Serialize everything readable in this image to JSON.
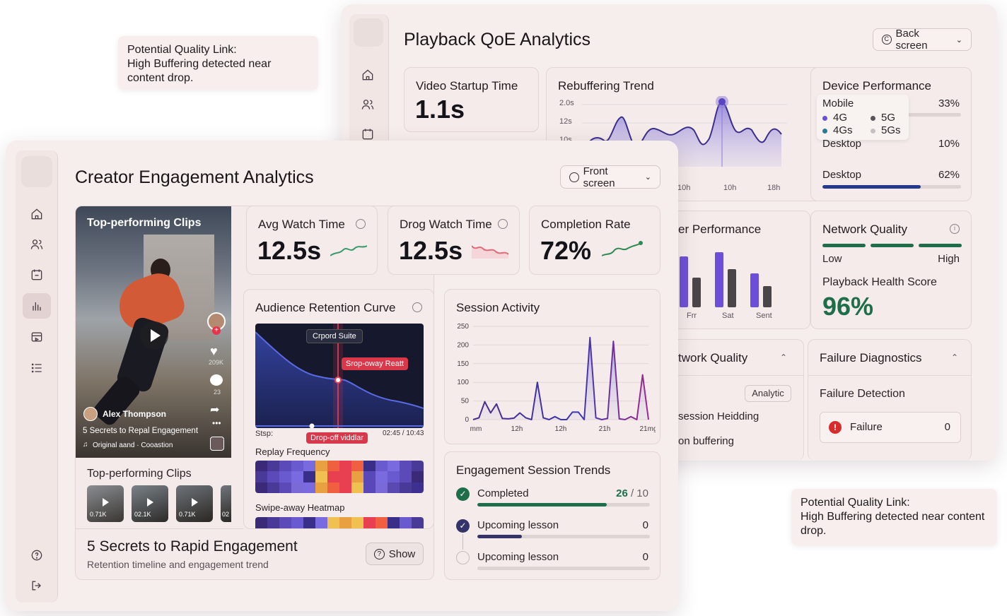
{
  "callouts": [
    {
      "title": "Potential Quality Link:",
      "body": "High Buffering detected near content drop."
    },
    {
      "title": "Potential Quality Link:",
      "body": "High Buffering detected near content drop."
    }
  ],
  "back": {
    "title": "Playback QoE Analytics",
    "screen_button": "Back screen",
    "startup": {
      "label": "Video Startup Time",
      "value": "1.1s"
    },
    "rebuffering": {
      "label": "Rebuffering Trend",
      "y_ticks": [
        "2.0s",
        "12s",
        "10s"
      ],
      "x_ticks": [
        "10h",
        "10h",
        "18h"
      ]
    },
    "device": {
      "label": "Device Performance",
      "rows": [
        {
          "name": "Mobile",
          "pct": "33%",
          "fill": 0.33,
          "color": "#6b4fd8"
        },
        {
          "name": "Desktop",
          "pct": "10%",
          "fill": 0.1,
          "color": "#2c3f8c"
        },
        {
          "name": "Desktop",
          "pct": "62%",
          "fill": 0.62,
          "color": "#243a8c"
        }
      ],
      "legend": [
        {
          "name": "4G",
          "color": "#6b4fd8"
        },
        {
          "name": "5G",
          "color": "#5a5358"
        },
        {
          "name": "4Gs",
          "color": "#2b7a9a"
        },
        {
          "name": "5Gs",
          "color": "#c9c0c4"
        }
      ]
    },
    "server": {
      "label": "er Performance",
      "x_ticks": [
        "Frr",
        "Sat",
        "Sent"
      ]
    },
    "network": {
      "label": "Network Quality",
      "low": "Low",
      "high": "High",
      "health_label": "Playback Health Score",
      "health_value": "96%"
    },
    "network2": {
      "label": "twork Quality",
      "tag": "Analytic",
      "line1": "session Heidding",
      "line2": "on buffering"
    },
    "failure": {
      "label": "Failure Diagnostics",
      "detection": "Failure Detection",
      "item": "Failure",
      "count": "0"
    }
  },
  "front": {
    "title": "Creator Engagement Analytics",
    "screen_button": "Front screen",
    "clip": {
      "header": "Top-performing Clips",
      "author": "Alex Thompson",
      "caption": "5 Secrets to Repal Engagement",
      "sound": "Original aand · Cooastion",
      "likes": "209K",
      "comments": "23"
    },
    "clips_list": {
      "label": "Top-performing Clips",
      "items": [
        "0.71K",
        "02.1K",
        "0.71K",
        "02"
      ]
    },
    "stat_cards": [
      {
        "label": "Avg Watch Time",
        "value": "12.5s",
        "trend_color": "#3a9a6a"
      },
      {
        "label": "Drog Watch Time",
        "value": "12.5s",
        "trend_color": "#e06a7a"
      },
      {
        "label": "Completion Rate",
        "value": "72%",
        "trend_color": "#2f8a52"
      }
    ],
    "retention": {
      "label": "Audience Retention Curve",
      "tip1": "Crpord Suite",
      "tip2": "Srop-oway Reatt",
      "drop_label": "Drop-off viddlar",
      "stsp": "Stsp:",
      "time": "02:45 / 10:43",
      "replay_label": "Replay Frequency",
      "swipe_label": "Swipe-away Heatmap"
    },
    "session": {
      "label": "Session Activity"
    },
    "engagement": {
      "label": "Engagement Session Trends",
      "rows": [
        {
          "name": "Completed",
          "value": "26",
          "total": "/ 10",
          "fill": 0.75
        },
        {
          "name": "Upcoming lesson",
          "value": "0",
          "fill": 0.26
        },
        {
          "name": "Upcoming lesson",
          "value": "0",
          "fill": 0
        }
      ]
    },
    "footer": {
      "title": "5 Secrets to Rapid Engagement",
      "subtitle": "Retention timeline and engagement trend",
      "button": "Show"
    }
  },
  "chart_data": [
    {
      "type": "line",
      "title": "Session Activity",
      "x_ticks": [
        "mm",
        "12h",
        "12h",
        "21h",
        "21mg"
      ],
      "y_ticks": [
        0,
        50,
        100,
        150,
        200,
        250
      ],
      "ylim": [
        0,
        250
      ],
      "values": [
        0,
        5,
        48,
        18,
        42,
        3,
        2,
        4,
        18,
        5,
        0,
        100,
        5,
        0,
        8,
        0,
        0,
        20,
        20,
        0,
        220,
        5,
        0,
        3,
        210,
        2,
        0,
        8,
        0,
        120,
        0
      ]
    }
  ]
}
